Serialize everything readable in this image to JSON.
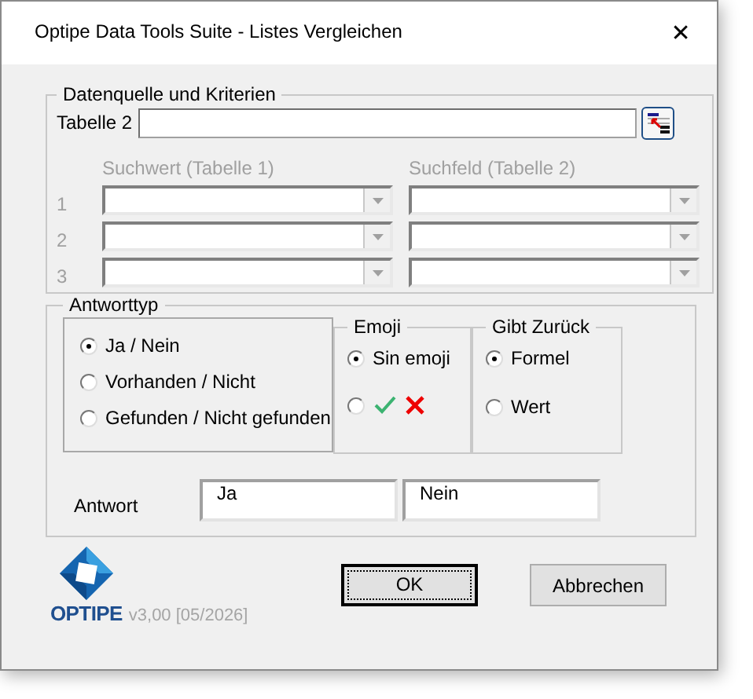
{
  "window": {
    "title": "Optipe Data Tools Suite - Listes Vergleichen",
    "close": "✕"
  },
  "criteria": {
    "legend": "Datenquelle und Kriterien",
    "table_label": "Tabelle 2",
    "disabled": true,
    "headers": [
      "Suchwert (Tabelle 1)",
      "Suchfeld (Tabelle 2)"
    ],
    "rows": [
      {
        "number": "1"
      },
      {
        "number": "2"
      },
      {
        "number": "3"
      }
    ]
  },
  "answer_type": {
    "legend": "Antworttyp",
    "options": [
      {
        "label": "Ja / Nein",
        "selected": true
      },
      {
        "label": "Vorhanden / Nicht",
        "selected": false
      },
      {
        "label": "Gefunden / Nicht gefunden",
        "selected": false
      }
    ],
    "emoji": {
      "legend": "Emoji",
      "options": [
        {
          "kind": "text",
          "label": "Sin emoji",
          "selected": true
        },
        {
          "kind": "icons",
          "selected": false
        }
      ]
    },
    "returns": {
      "legend": "Gibt Zurück",
      "options": [
        {
          "label": "Formel",
          "selected": true
        },
        {
          "label": "Wert",
          "selected": false
        }
      ]
    },
    "answer_label": "Antwort",
    "answers": [
      "Ja",
      "Nein"
    ]
  },
  "footer": {
    "brand": "OPTIPE",
    "version": "v3,00 [05/2026]",
    "buttons": [
      {
        "label": "OK",
        "default": true
      },
      {
        "label": "Abbrechen",
        "default": false
      }
    ]
  }
}
